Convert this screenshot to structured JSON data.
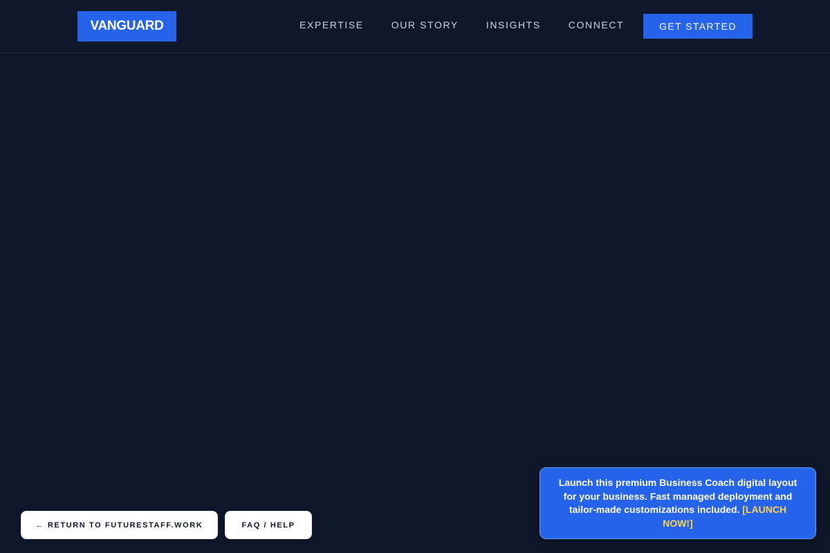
{
  "header": {
    "logo": "VANGUARD",
    "nav": [
      {
        "label": "EXPERTISE"
      },
      {
        "label": "OUR STORY"
      },
      {
        "label": "INSIGHTS"
      },
      {
        "label": "CONNECT"
      }
    ],
    "cta_label": "GET STARTED"
  },
  "footer_buttons": {
    "return_label": "← RETURN TO FUTURESTAFF.WORK",
    "faq_label": "FAQ / HELP"
  },
  "promo": {
    "text": "Launch this premium Business Coach digital layout for your business. Fast managed deployment and tailor-made customizations included. ",
    "link": "[LAUNCH NOW!]"
  },
  "colors": {
    "background": "#0f172a",
    "accent": "#2563eb",
    "promo_link": "#fcd34d"
  }
}
